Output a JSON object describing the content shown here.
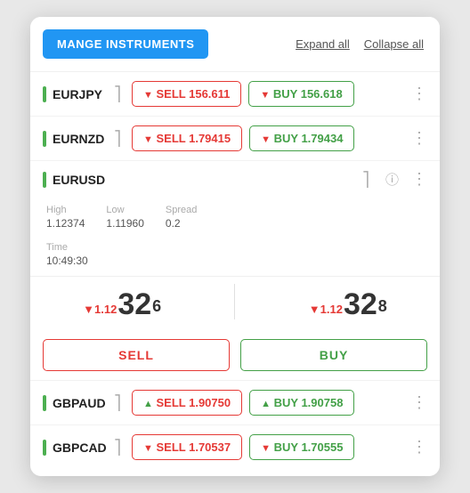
{
  "header": {
    "manage_label": "MANGE INSTRUMENTS",
    "expand_label": "Expand all",
    "collapse_label": "Collapse all"
  },
  "instruments": [
    {
      "id": "EURJPY",
      "name": "EURJPY",
      "sell_arrow": "▼",
      "sell_price": "156.611",
      "buy_arrow": "▼",
      "buy_price": "156.618",
      "expanded": false
    },
    {
      "id": "EURNZD",
      "name": "EURNZD",
      "sell_arrow": "▼",
      "sell_price": "1.79415",
      "buy_arrow": "▼",
      "buy_price": "1.79434",
      "expanded": false
    },
    {
      "id": "EURUSD",
      "name": "EURUSD",
      "expanded": true,
      "stats": {
        "high_label": "High",
        "high_value": "1.12374",
        "low_label": "Low",
        "low_value": "1.11960",
        "spread_label": "Spread",
        "spread_value": "0.2",
        "time_label": "Time",
        "time_value": "10:49:30"
      },
      "sell_price_small": "▼1.12",
      "sell_price_big": "32",
      "sell_price_sup": "6",
      "buy_price_small": "▼1.12",
      "buy_price_big": "32",
      "buy_price_sup": "8",
      "sell_label": "SELL",
      "buy_label": "BUY"
    },
    {
      "id": "GBPAUD",
      "name": "GBPAUD",
      "sell_arrow": "▲",
      "sell_price": "1.90750",
      "buy_arrow": "▲",
      "buy_price": "1.90758",
      "arrow_color_sell": "up",
      "arrow_color_buy": "up",
      "expanded": false
    },
    {
      "id": "GBPCAD",
      "name": "GBPCAD",
      "sell_arrow": "▼",
      "sell_price": "1.70537",
      "buy_arrow": "▼",
      "buy_price": "1.70555",
      "expanded": false
    }
  ]
}
